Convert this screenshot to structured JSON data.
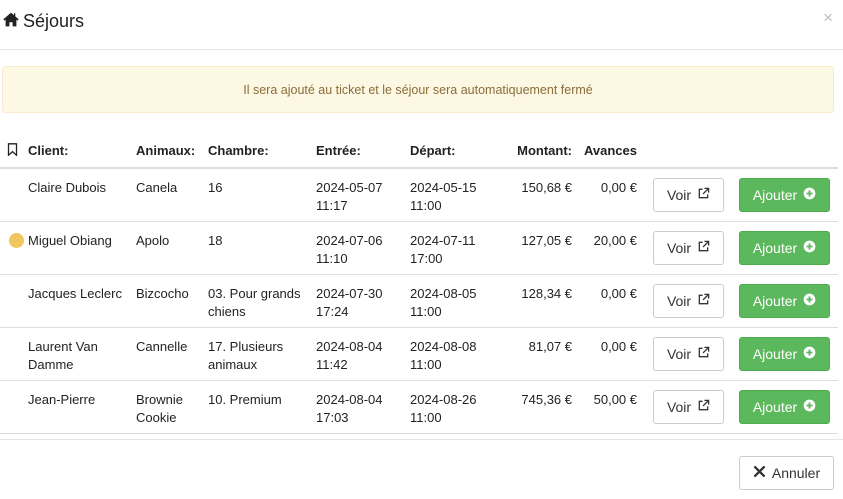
{
  "modal": {
    "title": "Séjours",
    "title_icon": "home-icon",
    "close_label": "×"
  },
  "alert": {
    "text": "Il sera ajouté au ticket et le séjour sera automatiquement fermé"
  },
  "table": {
    "headers": {
      "client": "Client:",
      "animaux": "Animaux:",
      "chambre": "Chambre:",
      "entree": "Entrée:",
      "depart": "Départ:",
      "montant": "Montant:",
      "avances": "Avances"
    },
    "rows": [
      {
        "marker": "none",
        "client": "Claire Dubois",
        "animaux": "Canela",
        "chambre": "16",
        "entree_date": "2024-05-07",
        "entree_time": "11:17",
        "depart_date": "2024-05-15",
        "depart_time": "11:00",
        "montant": "150,68 €",
        "avances": "0,00 €"
      },
      {
        "marker": "yellow-dot",
        "client": "Miguel Obiang",
        "animaux": "Apolo",
        "chambre": "18",
        "entree_date": "2024-07-06",
        "entree_time": "11:10",
        "depart_date": "2024-07-11",
        "depart_time": "17:00",
        "montant": "127,05 €",
        "avances": "20,00 €"
      },
      {
        "marker": "none",
        "client": "Jacques Leclerc",
        "animaux": "Bizcocho",
        "chambre": "03. Pour grands chiens",
        "entree_date": "2024-07-30",
        "entree_time": "17:24",
        "depart_date": "2024-08-05",
        "depart_time": "11:00",
        "montant": "128,34 €",
        "avances": "0,00 €"
      },
      {
        "marker": "none",
        "client": "Laurent Van Damme",
        "animaux": "Cannelle",
        "chambre": "17. Plusieurs animaux",
        "entree_date": "2024-08-04",
        "entree_time": "11:42",
        "depart_date": "2024-08-08",
        "depart_time": "11:00",
        "montant": "81,07 €",
        "avances": "0,00 €"
      },
      {
        "marker": "none",
        "client": "Jean-Pierre",
        "animaux": "Brownie Cookie",
        "chambre": "10. Premium",
        "entree_date": "2024-08-04",
        "entree_time": "17:03",
        "depart_date": "2024-08-26",
        "depart_time": "11:00",
        "montant": "745,36 €",
        "avances": "50,00 €"
      }
    ],
    "voir_label": "Voir",
    "ajouter_label": "Ajouter"
  },
  "footer": {
    "annuler_label": "Annuler"
  },
  "colors": {
    "alert_bg": "#fcf8e3",
    "alert_text": "#8a6d3b",
    "success": "#5cb85c",
    "marker_dot": "#f0c75e"
  }
}
